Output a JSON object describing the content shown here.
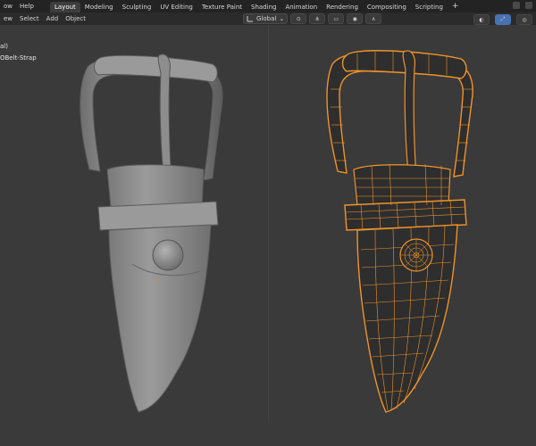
{
  "topbar": {
    "menus": [
      "ow",
      "Help"
    ],
    "tabs": [
      "Layout",
      "Modeling",
      "Sculpting",
      "UV Editing",
      "Texture Paint",
      "Shading",
      "Animation",
      "Rendering",
      "Compositing",
      "Scripting"
    ],
    "active_tab": "Layout",
    "add_tab": "+"
  },
  "header": {
    "menus": [
      "ew",
      "Select",
      "Add",
      "Object"
    ],
    "orientation": "Global"
  },
  "outliner": {
    "items": [
      "al)",
      "OBelt-Strap"
    ]
  },
  "colors": {
    "viewport_bg": "#3a3a3a",
    "solid_model": "#8f8f8f",
    "wire_orange": "#f0932a",
    "wire_fill": "#2b2b2b",
    "active_tab_bg": "#3d3d3d",
    "accent_blue": "#4772b3"
  }
}
